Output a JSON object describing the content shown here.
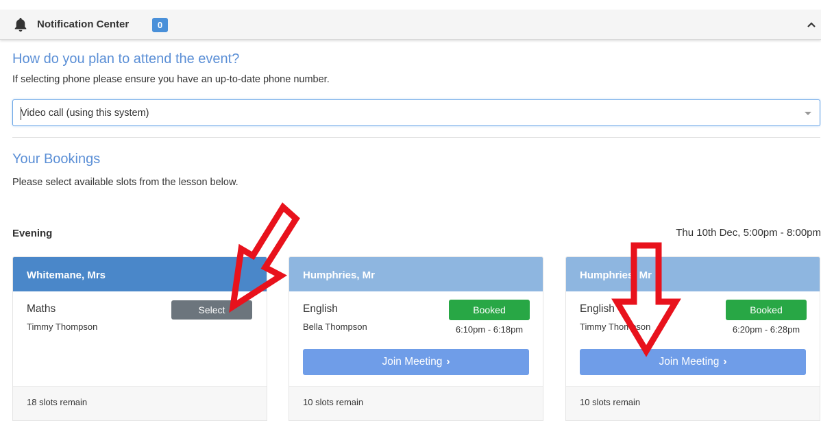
{
  "notification": {
    "title": "Notification Center",
    "count": "0"
  },
  "attend": {
    "heading": "How do you plan to attend the event?",
    "help": "If selecting phone please ensure you have an up-to-date phone number.",
    "selected_option": "Video call (using this system)"
  },
  "bookings": {
    "heading": "Your Bookings",
    "help": "Please select available slots from the lesson below.",
    "group_label": "Evening",
    "group_date": "Thu 10th Dec, 5:00pm - 8:00pm",
    "cards": [
      {
        "teacher": "Whitemane, Mrs",
        "subject": "Maths",
        "student": "Timmy Thompson",
        "action_label": "Select",
        "slots": "18 slots remain"
      },
      {
        "teacher": "Humphries, Mr",
        "subject": "English",
        "student": "Bella Thompson",
        "status": "Booked",
        "time": "6:10pm - 6:18pm",
        "join_label": "Join Meeting",
        "slots": "10 slots remain"
      },
      {
        "teacher": "Humphries, Mr",
        "subject": "English",
        "student": "Timmy Thompson",
        "status": "Booked",
        "time": "6:20pm - 6:28pm",
        "join_label": "Join Meeting",
        "slots": "10 slots remain"
      }
    ]
  },
  "colors": {
    "accent": "#5b8fd6",
    "header_active": "#4a87c9",
    "header_inactive": "#8eb6e0",
    "booked": "#28a745",
    "join": "#6f9de8",
    "select": "#6c757d",
    "annotation_arrow": "#e8121c"
  }
}
